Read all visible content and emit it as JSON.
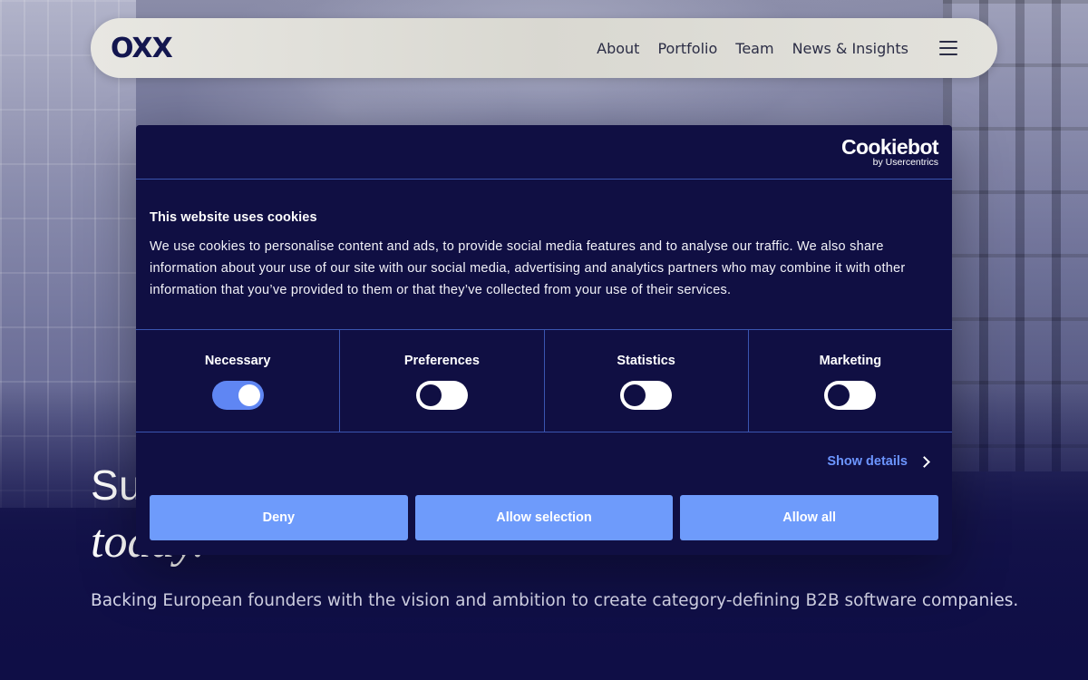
{
  "nav": {
    "logo": "OXX",
    "links": [
      "About",
      "Portfolio",
      "Team",
      "News & Insights"
    ],
    "menu_icon": "hamburger-menu-icon"
  },
  "hero": {
    "title_line1": "Su",
    "title_line2": "today.",
    "subtitle": "Backing European founders with the vision and ambition to create category-defining B2B software companies."
  },
  "cookie": {
    "brand_name": "Cookiebot",
    "brand_sub": "by Usercentrics",
    "title": "This website uses cookies",
    "text": "We use cookies to personalise content and ads, to provide social media features and to analyse our traffic. We also share information about your use of our site with our social media, advertising and analytics partners who may combine it with other information that you’ve provided to them or that they’ve collected from your use of their services.",
    "categories": [
      {
        "label": "Necessary",
        "enabled": true
      },
      {
        "label": "Preferences",
        "enabled": false
      },
      {
        "label": "Statistics",
        "enabled": false
      },
      {
        "label": "Marketing",
        "enabled": false
      }
    ],
    "show_details": "Show details",
    "buttons": {
      "deny": "Deny",
      "allow_selection": "Allow selection",
      "allow_all": "Allow all"
    },
    "colors": {
      "dialog_bg": "#100f43",
      "accent": "#6e9bfb",
      "link": "#6c95ff",
      "divider": "#3a55b0"
    }
  }
}
